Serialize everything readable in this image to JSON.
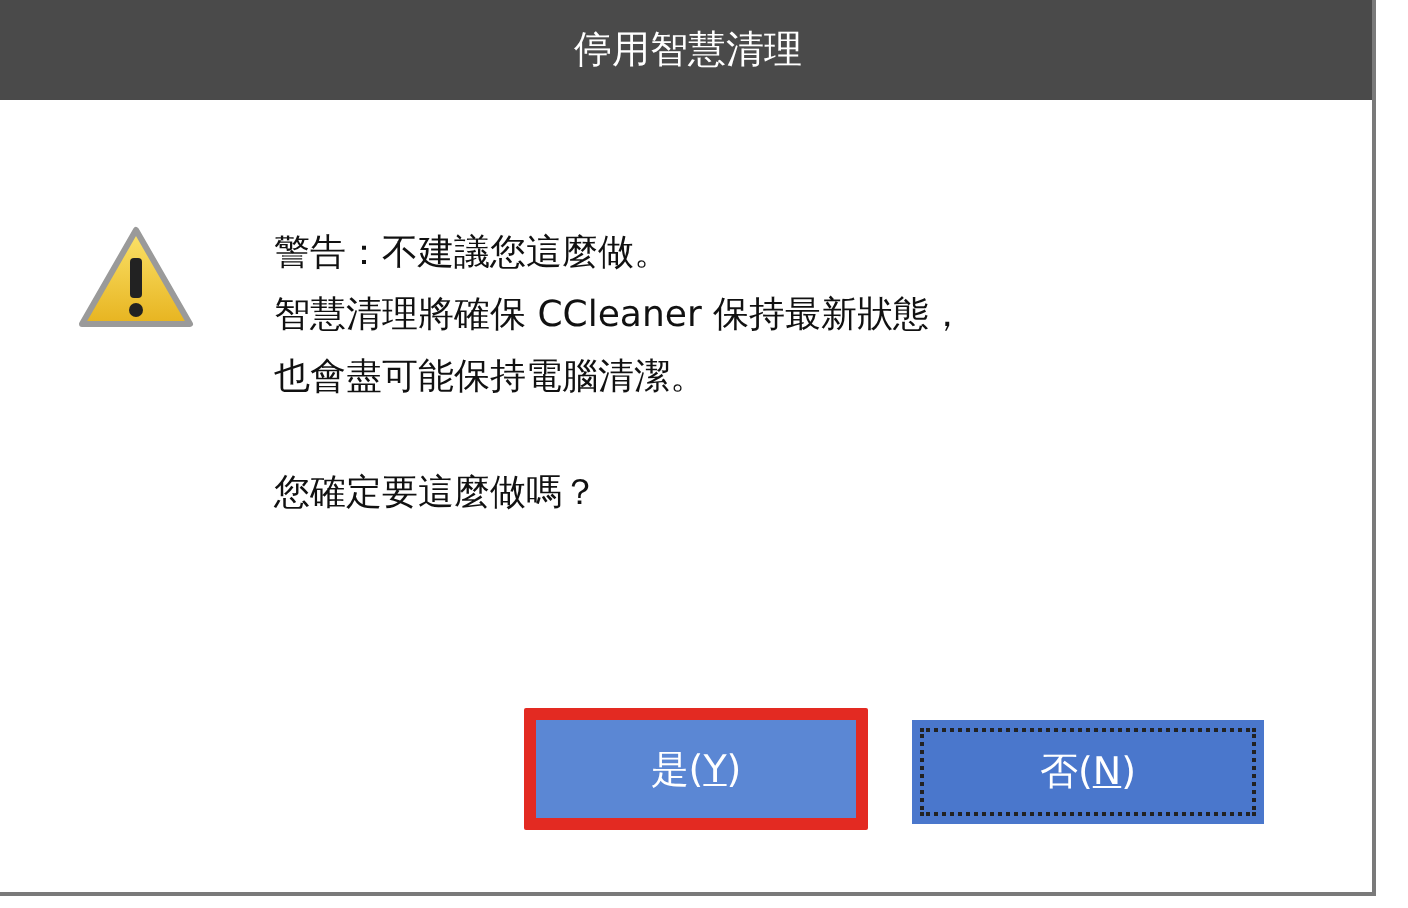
{
  "window": {
    "title": "停用智慧清理"
  },
  "message": {
    "lines": [
      "警告：不建議您這麼做。",
      "智慧清理將確保 CCleaner 保持最新狀態，",
      "也會盡可能保持電腦清潔。"
    ],
    "question": "您確定要這麼做嗎？"
  },
  "buttons": [
    {
      "label_before": "是(",
      "access_key": "Y",
      "label_after": ")",
      "focused": false,
      "highlighted": true
    },
    {
      "label_before": "否(",
      "access_key": "N",
      "label_after": ")",
      "focused": true,
      "highlighted": false
    }
  ]
}
